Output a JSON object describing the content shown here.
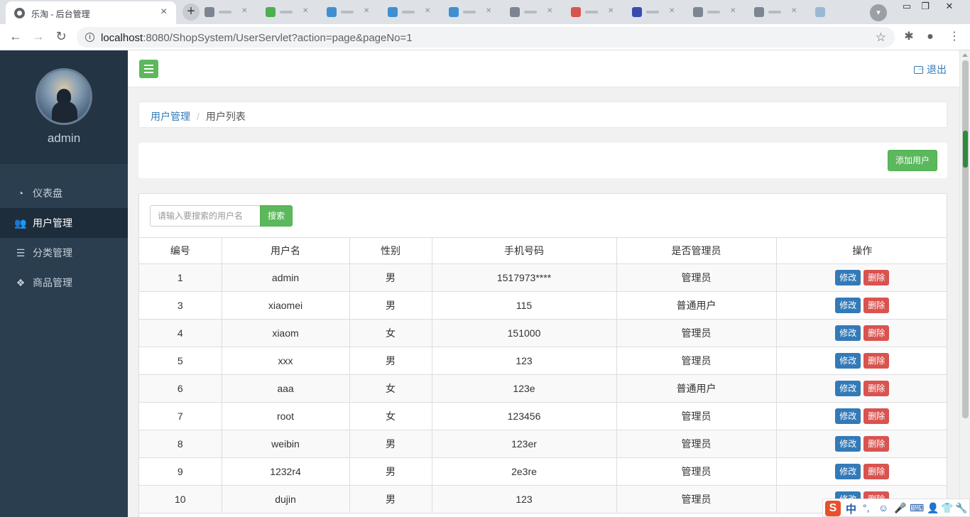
{
  "browser": {
    "tab_title": "乐淘 - 后台管理",
    "tab_close": "×",
    "new_tab": "+",
    "url_host": "localhost",
    "url_rest": ":8080/ShopSystem/UserServlet?action=page&pageNo=1"
  },
  "sidebar": {
    "username": "admin",
    "items": [
      {
        "label": "仪表盘",
        "icon": "dashboard-icon",
        "active": false
      },
      {
        "label": "用户管理",
        "icon": "users-icon",
        "active": true
      },
      {
        "label": "分类管理",
        "icon": "list-icon",
        "active": false
      },
      {
        "label": "商品管理",
        "icon": "cubes-icon",
        "active": false
      }
    ]
  },
  "topbar": {
    "logout_label": "退出"
  },
  "breadcrumb": {
    "parent": "用户管理",
    "separator": "/",
    "current": "用户列表"
  },
  "actions": {
    "add_user_label": "添加用户"
  },
  "search": {
    "placeholder": "请输入要搜索的用户名",
    "button_label": "搜索"
  },
  "table": {
    "headers": [
      "编号",
      "用户名",
      "性别",
      "手机号码",
      "是否管理员",
      "操作"
    ],
    "edit_label": "修改",
    "delete_label": "删除",
    "rows": [
      {
        "id": "1",
        "username": "admin",
        "gender": "男",
        "phone": "1517973****",
        "role": "管理员"
      },
      {
        "id": "3",
        "username": "xiaomei",
        "gender": "男",
        "phone": "115",
        "role": "普通用户"
      },
      {
        "id": "4",
        "username": "xiaom",
        "gender": "女",
        "phone": "151000",
        "role": "管理员"
      },
      {
        "id": "5",
        "username": "xxx",
        "gender": "男",
        "phone": "123",
        "role": "管理员"
      },
      {
        "id": "6",
        "username": "aaa",
        "gender": "女",
        "phone": "123e",
        "role": "普通用户"
      },
      {
        "id": "7",
        "username": "root",
        "gender": "女",
        "phone": "123456",
        "role": "管理员"
      },
      {
        "id": "8",
        "username": "weibin",
        "gender": "男",
        "phone": "123er",
        "role": "管理员"
      },
      {
        "id": "9",
        "username": "1232r4",
        "gender": "男",
        "phone": "2e3re",
        "role": "管理员"
      },
      {
        "id": "10",
        "username": "dujin",
        "gender": "男",
        "phone": "123",
        "role": "管理员"
      }
    ]
  },
  "ime": {
    "logo": "S",
    "mode": "中"
  },
  "colors": {
    "sidebar_bg": "#2b3e50",
    "primary": "#337ab7",
    "success": "#5cb85c",
    "danger": "#d9534f"
  }
}
